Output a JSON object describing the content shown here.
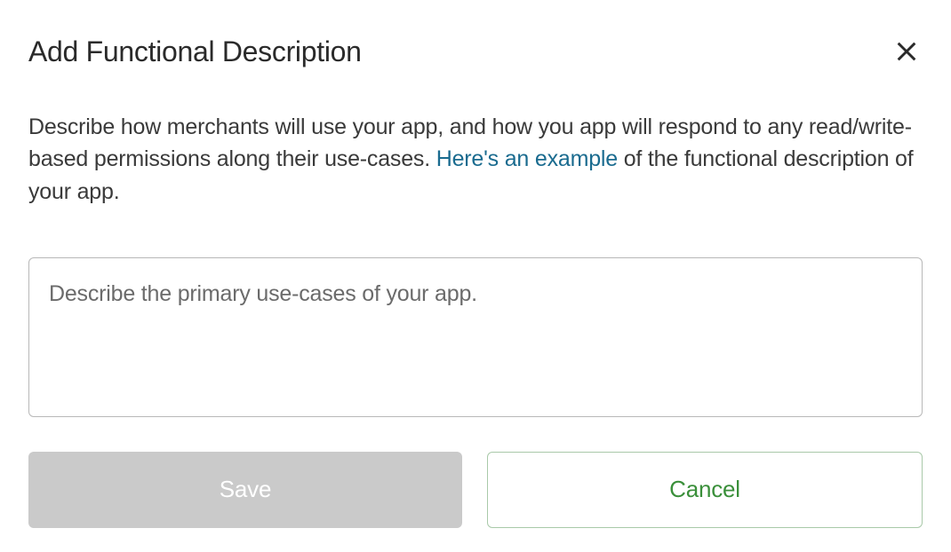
{
  "modal": {
    "title": "Add Functional Description",
    "description_part1": "Describe how merchants will use your app, and how you app will respond to any read/write-based permissions along their use-cases. ",
    "link_text": "Here's an example",
    "description_part2": " of the functional description of your app."
  },
  "form": {
    "textarea_placeholder": "Describe the primary use-cases of your app.",
    "textarea_value": ""
  },
  "buttons": {
    "save_label": "Save",
    "cancel_label": "Cancel"
  }
}
